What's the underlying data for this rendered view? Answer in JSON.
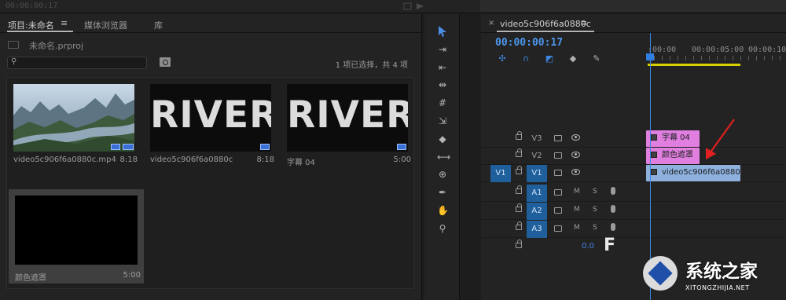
{
  "top": {
    "timecode": "00:00:00:17"
  },
  "project": {
    "tabs": [
      {
        "label": "项目:未命名"
      },
      {
        "label": "媒体浏览器"
      },
      {
        "label": "库"
      }
    ],
    "menu_glyph": "≡",
    "file_name": "未命名.prproj",
    "search_placeholder": "",
    "selection_status": "1 项已选择，共 4 项",
    "clips": [
      {
        "name": "video5c906f6a0880c.mp4",
        "duration": "8:18",
        "thumb": "landscape"
      },
      {
        "name": "video5c906f6a0880c",
        "duration": "8:18",
        "thumb": "RIVER"
      },
      {
        "name": "字幕 04",
        "duration": "5:00",
        "thumb": "RIVER"
      },
      {
        "name": "颜色遮罩",
        "duration": "5:00",
        "thumb": "black"
      }
    ]
  },
  "tools": [
    "selection-tool",
    "track-select-tool",
    "ripple-edit-tool",
    "rolling-edit-tool",
    "rate-stretch-tool",
    "razor-tool",
    "slip-tool",
    "slide-tool",
    "pen-tool",
    "hand-tool",
    "zoom-tool"
  ],
  "timeline": {
    "close_glyph": "×",
    "sequence_name": "video5c906f6a0880c",
    "menu_glyph": "≡",
    "timecode": "00:00:00:17",
    "ruler": [
      ":00:00",
      "00:00:05:00",
      "00:00:10:00"
    ],
    "source_patch": "V1",
    "tracks": [
      {
        "name": "V3",
        "kind": "video",
        "clip": "字幕 04",
        "clip_color": "#e07fe0"
      },
      {
        "name": "V2",
        "kind": "video",
        "clip": "颜色遮罩",
        "clip_color": "#e07fe0"
      },
      {
        "name": "V1",
        "kind": "video",
        "clip": "video5c906f6a0880c.",
        "clip_color": "#8db0dd"
      },
      {
        "name": "A1",
        "kind": "audio",
        "mute": "M",
        "solo": "S"
      },
      {
        "name": "A2",
        "kind": "audio",
        "mute": "M",
        "solo": "S"
      },
      {
        "name": "A3",
        "kind": "audio",
        "mute": "M",
        "solo": "S"
      }
    ],
    "master_volume": "0.0"
  },
  "watermark": {
    "title": "系统之家",
    "subtitle": "XITONGZHIJIA.NET"
  },
  "colors": {
    "accent": "#4d97ec",
    "track_highlight": "#1f5f9c",
    "workarea": "#d9d000",
    "annotation_arrow": "#e02020"
  }
}
